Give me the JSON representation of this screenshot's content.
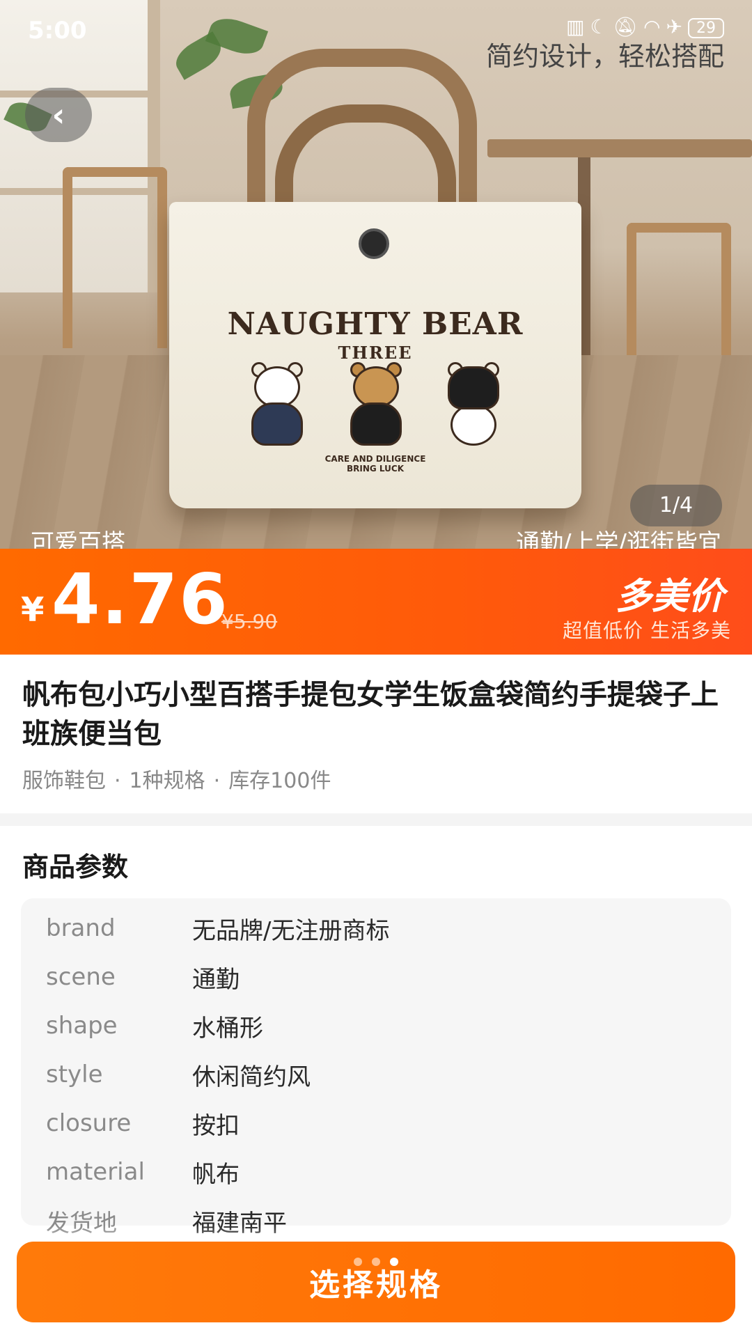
{
  "status_bar": {
    "time": "5:00",
    "icons": [
      "nfc-icon",
      "moon-icon",
      "mute-icon",
      "wifi-icon",
      "airplane-icon"
    ],
    "battery": "29"
  },
  "hero": {
    "caption_top": "简约设计，轻松搭配",
    "caption_bottom_left": "可爱百搭",
    "caption_bottom_right": "通勤/上学/逛街皆宜",
    "image_counter": "1/4",
    "bag_print": {
      "title": "NAUGHTY BEAR",
      "subtitle": "THREE",
      "footer_line1": "CARE AND DILIGENCE",
      "footer_line2": "BRING LUCK"
    }
  },
  "price": {
    "currency": "¥",
    "current": "4.76",
    "original": "¥5.90",
    "promo_title": "多美价",
    "promo_subtitle": "超值低价 生活多美"
  },
  "product": {
    "title": "帆布包小巧小型百搭手提包女学生饭盒袋简约手提袋子上班族便当包",
    "category": "服饰鞋包",
    "spec_count": "1种规格",
    "stock": "库存100件",
    "separator": "·"
  },
  "params": {
    "heading": "商品参数",
    "rows": [
      {
        "key": "brand",
        "value": "无品牌/无注册商标"
      },
      {
        "key": "scene",
        "value": "通勤"
      },
      {
        "key": "shape",
        "value": "水桶形"
      },
      {
        "key": "style",
        "value": "休闲简约风"
      },
      {
        "key": "closure",
        "value": "按扣"
      },
      {
        "key": "material",
        "value": "帆布"
      },
      {
        "key": "发货地",
        "value": "福建南平"
      }
    ]
  },
  "cta": {
    "label": "选择规格",
    "color": "#ff6a00"
  },
  "colors": {
    "accent": "#ff6a00",
    "muted_text": "#888888"
  }
}
